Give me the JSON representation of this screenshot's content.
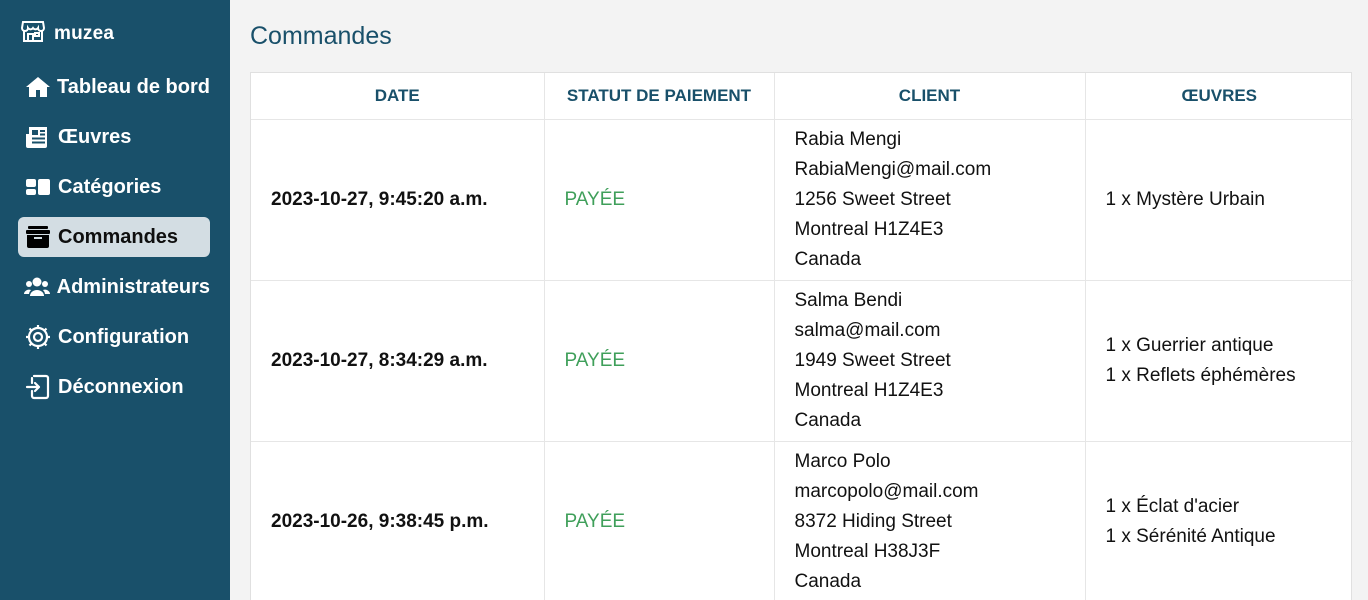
{
  "brand": {
    "name": "muzea"
  },
  "sidebar": {
    "items": [
      {
        "label": "Tableau de bord",
        "icon": "home-icon"
      },
      {
        "label": "Œuvres",
        "icon": "newspaper-icon"
      },
      {
        "label": "Catégories",
        "icon": "categories-icon"
      },
      {
        "label": "Commandes",
        "icon": "box-icon",
        "active": true
      },
      {
        "label": "Administrateurs",
        "icon": "users-icon"
      },
      {
        "label": "Configuration",
        "icon": "gear-icon"
      },
      {
        "label": "Déconnexion",
        "icon": "logout-icon"
      }
    ]
  },
  "main": {
    "title": "Commandes",
    "table": {
      "headers": [
        "DATE",
        "STATUT DE PAIEMENT",
        "CLIENT",
        "ŒUVRES"
      ],
      "rows": [
        {
          "date": "2023-10-27, 9:45:20 a.m.",
          "status": "PAYÉE",
          "client": {
            "name": "Rabia Mengi",
            "email": "RabiaMengi@mail.com",
            "street": "1256 Sweet Street",
            "city": "Montreal H1Z4E3",
            "country": "Canada"
          },
          "items": [
            "1 x Mystère Urbain"
          ]
        },
        {
          "date": "2023-10-27, 8:34:29 a.m.",
          "status": "PAYÉE",
          "client": {
            "name": "Salma Bendi",
            "email": "salma@mail.com",
            "street": "1949 Sweet Street",
            "city": "Montreal H1Z4E3",
            "country": "Canada"
          },
          "items": [
            "1 x Guerrier antique",
            "1 x Reflets éphémères"
          ]
        },
        {
          "date": "2023-10-26, 9:38:45 p.m.",
          "status": "PAYÉE",
          "client": {
            "name": "Marco Polo",
            "email": "marcopolo@mail.com",
            "street": "8372 Hiding Street",
            "city": "Montreal H38J3F",
            "country": "Canada"
          },
          "items": [
            "1 x Éclat d'acier",
            "1 x Sérénité Antique"
          ]
        }
      ]
    }
  },
  "colors": {
    "sidebar": "#19506a",
    "active_bg": "#d3dde3",
    "accent": "#19506a",
    "paid": "#3f9f5a"
  }
}
